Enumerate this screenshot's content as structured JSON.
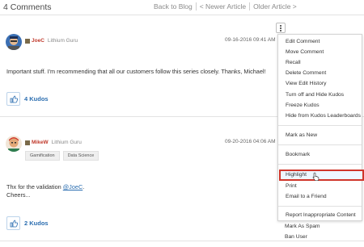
{
  "header": {
    "title": "4 Comments",
    "nav": [
      "Back to Blog",
      "< Newer Article",
      "Older Article >"
    ]
  },
  "comments": [
    {
      "author": "JoeC",
      "rank": "Lithium Guru",
      "date": "09-16-2016 09:41 AM",
      "body": "Important stuff. I'm recommending that all our customers follow this series closely. Thanks, Michael!",
      "kudos": "4 Kudos"
    },
    {
      "author": "MikeW",
      "rank": "Lithium Guru",
      "date": "09-20-2016 04:06 AM",
      "tags": [
        "Gamification",
        "Data Science"
      ],
      "body_line1_prefix": "Thx for the validation ",
      "body_line1_mention": "@JoeC",
      "body_line1_suffix": ".",
      "body_line2": "Cheers...",
      "kudos": "2 Kudos"
    }
  ],
  "menu": {
    "group1": [
      "Edit Comment",
      "Move Comment",
      "Recall",
      "Delete Comment",
      "View Edit History",
      "Turn off and Hide Kudos",
      "Freeze Kudos",
      "Hide from Kudos Leaderboards"
    ],
    "group2": [
      "Mark as New"
    ],
    "group3": [
      "Bookmark"
    ],
    "group4": [
      "Highlight",
      "Print",
      "Email to a Friend"
    ],
    "group5": [
      "Report Inappropriate Content",
      "Mark As Spam",
      "Ban User"
    ]
  },
  "colors": {
    "accent_link": "#2a6db0",
    "author": "#c0392b",
    "highlight_border": "#d0362b"
  }
}
